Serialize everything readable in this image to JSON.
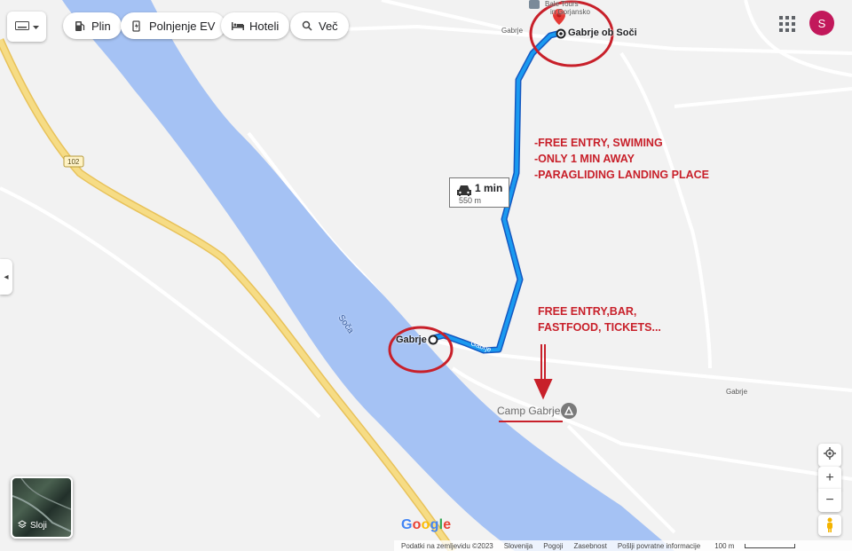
{
  "toolbar": {
    "chips": [
      {
        "label": "Plin",
        "icon": "gas-station-icon"
      },
      {
        "label": "Polnjenje EV",
        "icon": "ev-charging-icon"
      },
      {
        "label": "Hoteli",
        "icon": "hotel-bed-icon"
      },
      {
        "label": "Več",
        "icon": "search-icon"
      }
    ],
    "avatar_letter": "S"
  },
  "map": {
    "road_shield": "102",
    "river_name": "Soča",
    "road_labels": [
      "Gabrje",
      "Gabrje",
      "Gabrje"
    ],
    "places": {
      "start": "Gabrje",
      "destination": "Gabrje ob Soči",
      "poi_line1": "Bale Tours",
      "poi_line2": "in Gorjansko",
      "camp": "Camp Gabrje"
    },
    "route": {
      "time": "1 min",
      "distance": "550 m",
      "color": "#1a73e8"
    },
    "colors": {
      "river": "#a5c2f4",
      "main_road": "#f3d57a",
      "annotation": "#c8202a"
    }
  },
  "annotations": {
    "top_lines": [
      "-FREE ENTRY, SWIMING",
      "-ONLY 1 MIN AWAY",
      "-PARAGLIDING LANDING PLACE"
    ],
    "bottom_lines": [
      "FREE ENTRY,BAR,",
      "FASTFOOD, TICKETS..."
    ]
  },
  "layers_button": {
    "label": "Sloji"
  },
  "controls": {
    "zoom_in": "+",
    "zoom_out": "−"
  },
  "footer": {
    "google_letters": [
      "G",
      "o",
      "o",
      "g",
      "l",
      "e"
    ],
    "items": [
      "Podatki na zemljevidu ©2023",
      "Slovenija",
      "Pogoji",
      "Zasebnost",
      "Pošlji povratne informacije"
    ],
    "scale": "100 m"
  }
}
